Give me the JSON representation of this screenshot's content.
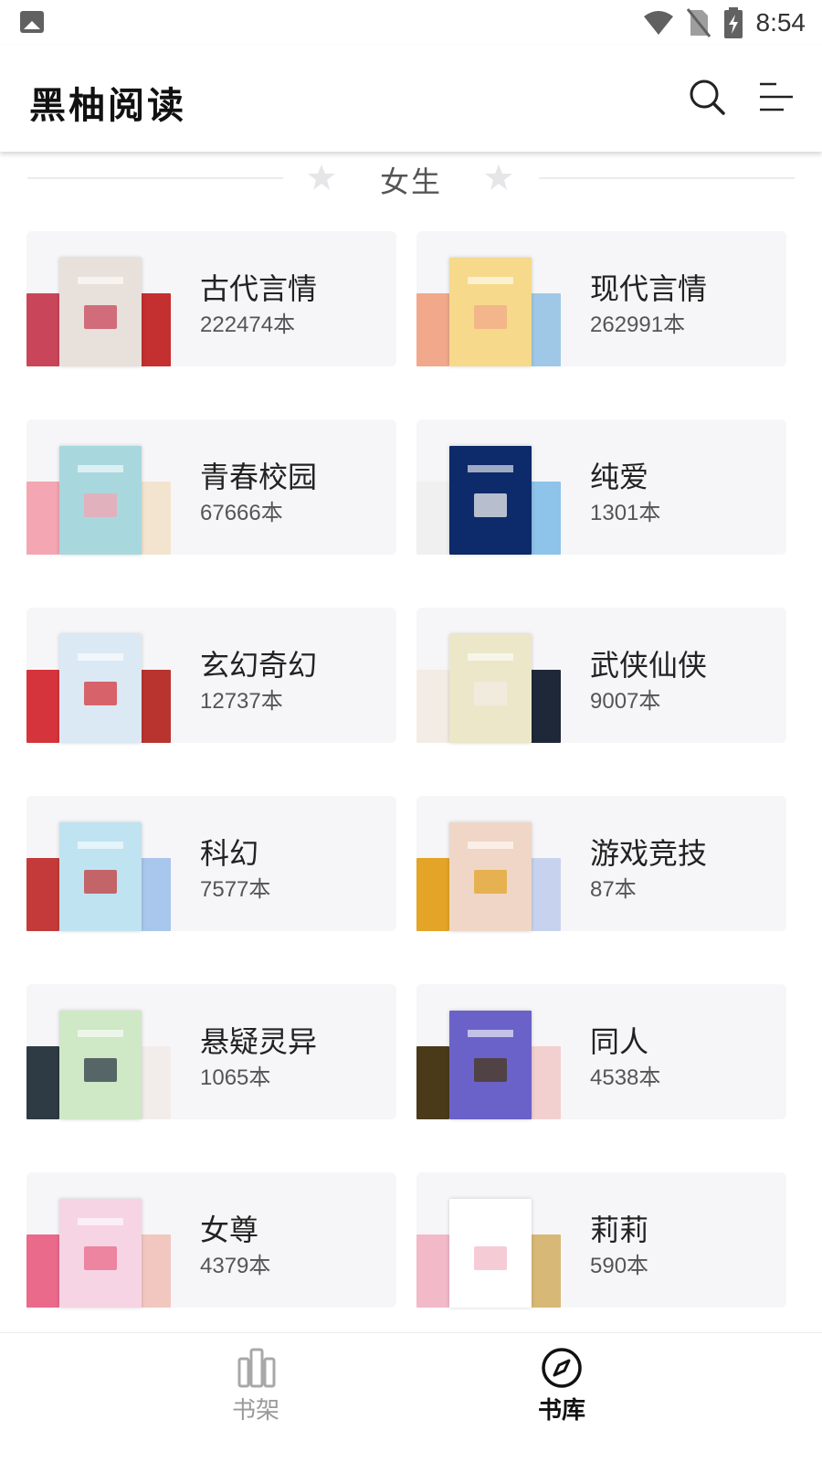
{
  "status_bar": {
    "time": "8:54",
    "icons": [
      "image-icon",
      "wifi-icon",
      "no-sim-icon",
      "battery-charging-icon"
    ]
  },
  "app_bar": {
    "title": "黑柚阅读",
    "icons": [
      "search-icon",
      "menu-list-icon"
    ]
  },
  "section": {
    "title": "女生",
    "icons": [
      "star-icon",
      "star-icon"
    ]
  },
  "categories": [
    {
      "name": "古代言情",
      "count": "222474本",
      "colors": [
        "#c9465a",
        "#e8e0da",
        "#c42f2f"
      ]
    },
    {
      "name": "现代言情",
      "count": "262991本",
      "colors": [
        "#f2a88a",
        "#f6d98a",
        "#9fc8e6"
      ]
    },
    {
      "name": "青春校园",
      "count": "67666本",
      "colors": [
        "#f4a6b2",
        "#a8d8de",
        "#f3e4cf"
      ]
    },
    {
      "name": "纯爱",
      "count": "1301本",
      "colors": [
        "#f0f0f0",
        "#0d2a6a",
        "#8ec3ea"
      ]
    },
    {
      "name": "玄幻奇幻",
      "count": "12737本",
      "colors": [
        "#d6343c",
        "#dbe9f4",
        "#b9342e"
      ]
    },
    {
      "name": "武侠仙侠",
      "count": "9007本",
      "colors": [
        "#f3ece5",
        "#ece7c8",
        "#1e2838"
      ]
    },
    {
      "name": "科幻",
      "count": "7577本",
      "colors": [
        "#c43a3a",
        "#bfe3f1",
        "#a9c6ec"
      ]
    },
    {
      "name": "游戏竞技",
      "count": "87本",
      "colors": [
        "#e3a428",
        "#f0d6c6",
        "#c7d3ee"
      ]
    },
    {
      "name": "悬疑灵异",
      "count": "1065本",
      "colors": [
        "#2e3a44",
        "#cfe8c6",
        "#f2ecea"
      ]
    },
    {
      "name": "同人",
      "count": "4538本",
      "colors": [
        "#4a3a1a",
        "#6a62c8",
        "#f2d0d0"
      ]
    },
    {
      "name": "女尊",
      "count": "4379本",
      "colors": [
        "#e96a8a",
        "#f6d4e4",
        "#f1c7c0"
      ]
    },
    {
      "name": "莉莉",
      "count": "590本",
      "colors": [
        "#f2b9c8",
        "#ffffff",
        "#d8b877"
      ]
    }
  ],
  "bottom_nav": {
    "items": [
      {
        "label": "书架",
        "icon": "bookshelf-icon",
        "active": false
      },
      {
        "label": "书库",
        "icon": "compass-icon",
        "active": true
      }
    ]
  }
}
